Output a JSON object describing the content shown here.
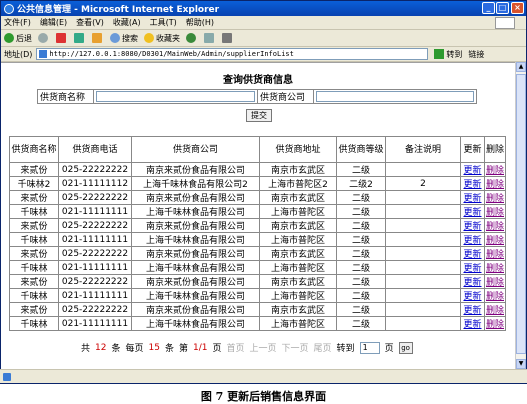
{
  "window": {
    "title": "公共信息管理 - Microsoft Internet Explorer"
  },
  "menu": [
    "文件(F)",
    "编辑(E)",
    "查看(V)",
    "收藏(A)",
    "工具(T)",
    "帮助(H)"
  ],
  "toolbar": {
    "back": "后退",
    "search": "搜索",
    "favorites": "收藏夹"
  },
  "address": {
    "label": "地址(D)",
    "url": "http://127.0.0.1:8080/D0301/MainWeb/Admin/supplierInfoList",
    "go": "转到",
    "links": "链接"
  },
  "page": {
    "title": "查询供货商信息",
    "search_name_label": "供货商名称",
    "search_company_label": "供货商公司",
    "query_button": "提交"
  },
  "table": {
    "headers": [
      "供货商名称",
      "供货商电话",
      "供货商公司",
      "供货商地址",
      "供货商等级",
      "备注说明",
      "更新",
      "删除"
    ],
    "rows": [
      [
        "来贰份",
        "025-22222222",
        "南京来贰份食品有限公司",
        "南京市玄武区",
        "二级",
        "",
        "更新",
        "删除"
      ],
      [
        "千味林2",
        "021-11111112",
        "上海千味林食品有限公司2",
        "上海市普陀区2",
        "二级2",
        "2",
        "更新",
        "删除"
      ],
      [
        "来贰份",
        "025-22222222",
        "南京来贰份食品有限公司",
        "南京市玄武区",
        "二级",
        "",
        "更新",
        "删除"
      ],
      [
        "千味林",
        "021-11111111",
        "上海千味林食品有限公司",
        "上海市普陀区",
        "二级",
        "",
        "更新",
        "删除"
      ],
      [
        "来贰份",
        "025-22222222",
        "南京来贰份食品有限公司",
        "南京市玄武区",
        "二级",
        "",
        "更新",
        "删除"
      ],
      [
        "千味林",
        "021-11111111",
        "上海千味林食品有限公司",
        "上海市普陀区",
        "二级",
        "",
        "更新",
        "删除"
      ],
      [
        "来贰份",
        "025-22222222",
        "南京来贰份食品有限公司",
        "南京市玄武区",
        "二级",
        "",
        "更新",
        "删除"
      ],
      [
        "千味林",
        "021-11111111",
        "上海千味林食品有限公司",
        "上海市普陀区",
        "二级",
        "",
        "更新",
        "删除"
      ],
      [
        "来贰份",
        "025-22222222",
        "南京来贰份食品有限公司",
        "南京市玄武区",
        "二级",
        "",
        "更新",
        "删除"
      ],
      [
        "千味林",
        "021-11111111",
        "上海千味林食品有限公司",
        "上海市普陀区",
        "二级",
        "",
        "更新",
        "删除"
      ],
      [
        "来贰份",
        "025-22222222",
        "南京来贰份食品有限公司",
        "南京市玄武区",
        "二级",
        "",
        "更新",
        "删除"
      ],
      [
        "千味林",
        "021-11111111",
        "上海千味林食品有限公司",
        "上海市普陀区",
        "二级",
        "",
        "更新",
        "删除"
      ]
    ]
  },
  "pagination": {
    "total_prefix": "共",
    "total": "12",
    "total_suffix": "条",
    "per_prefix": "每页",
    "per": "15",
    "per_suffix": "条",
    "page_prefix": "第",
    "page": "1/1",
    "page_suffix": "页",
    "first": "首页",
    "prev": "上一页",
    "next": "下一页",
    "last": "尾页",
    "goto": "转到",
    "goto_value": "1",
    "goto_suffix": "页",
    "go": "go"
  },
  "caption": "图 7  更新后销售信息界面"
}
